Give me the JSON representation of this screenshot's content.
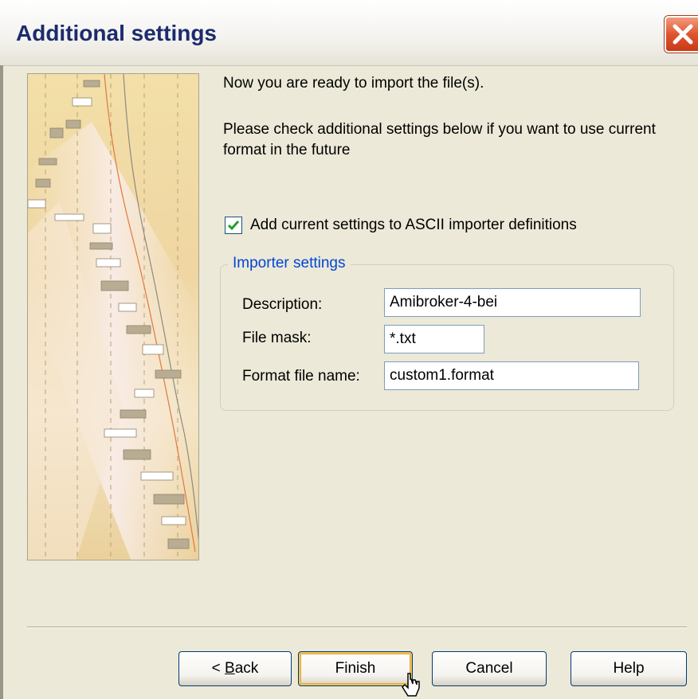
{
  "window": {
    "title": "Additional settings",
    "close_label": "X"
  },
  "content": {
    "intro": "Now you are ready to import the file(s).",
    "instructions": "Please check additional settings below if you want to use current format in the future"
  },
  "checkbox": {
    "checked": true,
    "label": "Add current settings to ASCII importer definitions"
  },
  "importer_settings": {
    "legend": "Importer settings",
    "description_label": "Description:",
    "description_value": "Amibroker-4-bei",
    "file_mask_label": "File mask:",
    "file_mask_value": "*.txt",
    "format_file_label": "Format file name:",
    "format_file_value": "custom1.format"
  },
  "buttons": {
    "back_prefix": "< ",
    "back_accel": "B",
    "back_rest": "ack",
    "finish": "Finish",
    "cancel": "Cancel",
    "help": "Help"
  },
  "colors": {
    "dialog_bg": "#ECE9D8",
    "title_text": "#1C2B6E",
    "legend_text": "#0046D5",
    "close_button": "#E0552F",
    "checkmark": "#21A121"
  },
  "icons": {
    "close": "close-icon",
    "checkmark": "checkmark-icon",
    "cursor": "mouse-cursor-icon"
  }
}
